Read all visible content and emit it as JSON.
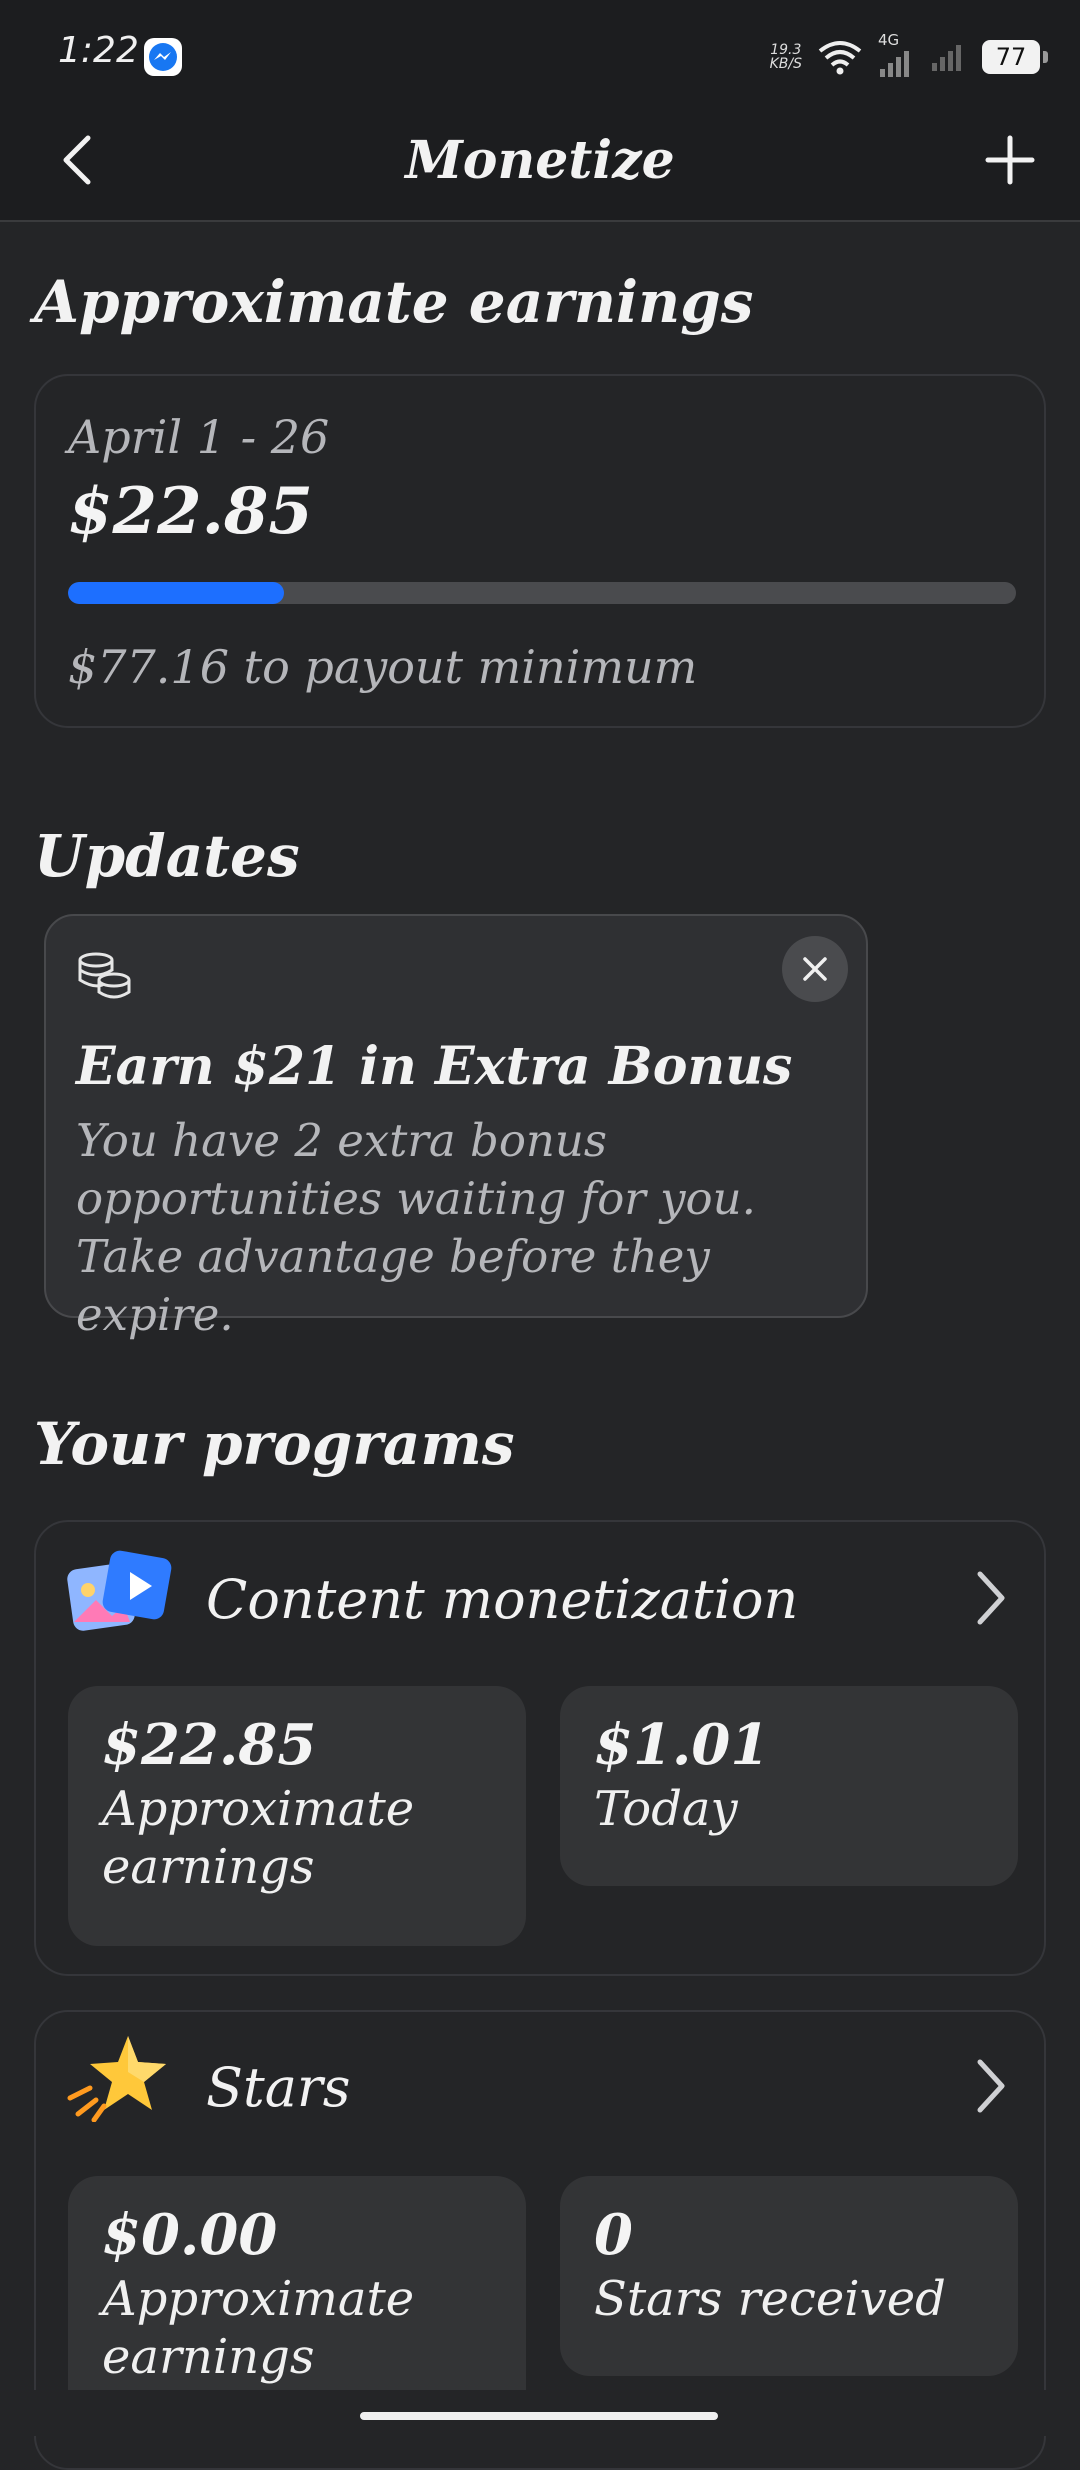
{
  "status_bar": {
    "time": "1:22",
    "net_speed_value": "19.3",
    "net_speed_unit": "KB/S",
    "network_type": "4G",
    "battery": "77"
  },
  "header": {
    "title": "Monetize",
    "back_icon": "chevron-left-icon",
    "add_icon": "plus-icon"
  },
  "earnings": {
    "section_title": "Approximate earnings",
    "period": "April 1 - 26",
    "amount": "$22.85",
    "progress_fraction": 0.228,
    "payout_text": "$77.16 to payout minimum"
  },
  "updates": {
    "section_title": "Updates",
    "card": {
      "icon": "coins-icon",
      "title": "Earn $21 in Extra Bonus",
      "body": "You have 2 extra bonus opportunities waiting for you. Take advantage before they expire."
    }
  },
  "programs": {
    "section_title": "Your programs",
    "items": [
      {
        "name": "Content monetization",
        "icon": "content-monetization-icon",
        "stats": [
          {
            "value": "$22.85",
            "label": "Approximate earnings"
          },
          {
            "value": "$1.01",
            "label": "Today"
          }
        ]
      },
      {
        "name": "Stars",
        "icon": "star-icon",
        "stats": [
          {
            "value": "$0.00",
            "label": "Approximate earnings"
          },
          {
            "value": "0",
            "label": "Stars received"
          }
        ]
      }
    ]
  },
  "colors": {
    "accent": "#1d6fff",
    "background": "#242527",
    "card_bg": "#2f3033"
  }
}
